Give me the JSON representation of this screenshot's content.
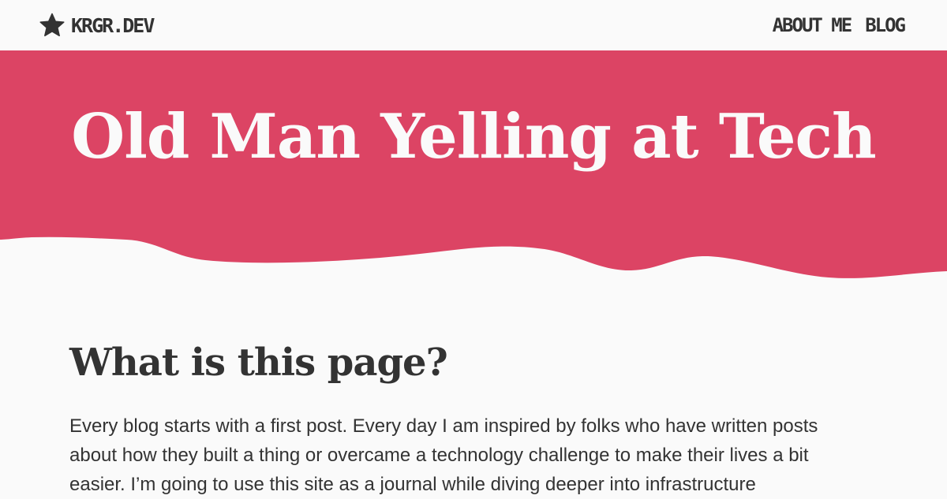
{
  "site": {
    "brand_name": "KRGR.DEV",
    "brand_icon": "star-icon"
  },
  "nav": {
    "items": [
      {
        "label": "ABOUT ME"
      },
      {
        "label": "BLOG"
      }
    ]
  },
  "hero": {
    "title": "Old Man Yelling at Tech"
  },
  "article": {
    "heading": "What is this page?",
    "body": "Every blog starts with a first post. Every day I am inspired by folks who have written posts about how they built a thing or overcame a technology challenge to make their lives a bit easier. I’m going to use this site as a journal while diving deeper into infrastructure"
  },
  "colors": {
    "accent": "#dc4464",
    "background": "#fafafa",
    "text": "#333333"
  }
}
